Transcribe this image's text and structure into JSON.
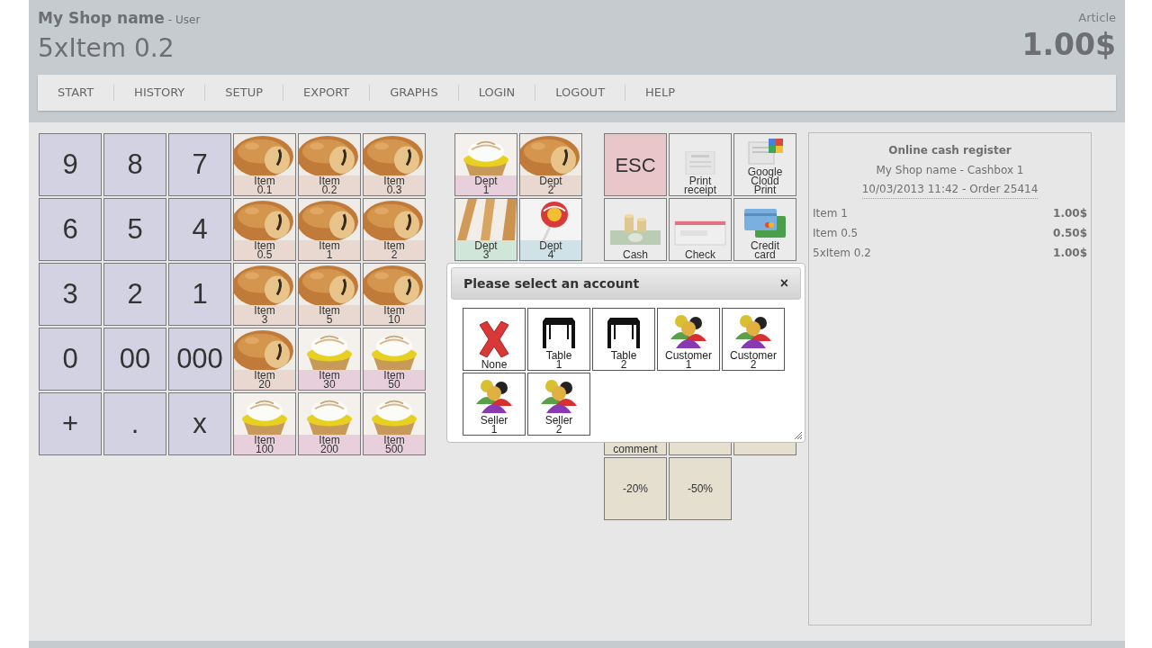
{
  "header": {
    "shop": "My Shop name",
    "user": "- User",
    "line": "5xItem 0.2",
    "total_label": "Article",
    "total": "1.00$"
  },
  "menu": [
    "START",
    "HISTORY",
    "SETUP",
    "EXPORT",
    "GRAPHS",
    "LOGIN",
    "LOGOUT",
    "HELP"
  ],
  "keypad": [
    "9",
    "8",
    "7",
    "6",
    "5",
    "4",
    "3",
    "2",
    "1",
    "0",
    "00",
    "000",
    "+",
    ".",
    "x"
  ],
  "items": [
    {
      "label": "Item 0.1",
      "color": "#e8d8cf"
    },
    {
      "label": "Item 0.2",
      "color": "#e8d8cf"
    },
    {
      "label": "Item 0.3",
      "color": "#e8d8cf"
    },
    {
      "label": "Item 0.5",
      "color": "#e8d8cf"
    },
    {
      "label": "Item 1",
      "color": "#e8d8cf"
    },
    {
      "label": "Item 2",
      "color": "#e8d8cf"
    },
    {
      "label": "Item 3",
      "color": "#e8d8cf"
    },
    {
      "label": "Item 5",
      "color": "#e8d8cf"
    },
    {
      "label": "Item 10",
      "color": "#e8d8cf"
    },
    {
      "label": "Item 20",
      "color": "#e8d8cf"
    },
    {
      "label": "Item 30",
      "color": "#e8cfdc"
    },
    {
      "label": "Item 50",
      "color": "#e8cfdc"
    },
    {
      "label": "Item 100",
      "color": "#e8cfdc"
    },
    {
      "label": "Item 200",
      "color": "#e8cfdc"
    },
    {
      "label": "Item 500",
      "color": "#e8cfdc"
    }
  ],
  "departments": [
    {
      "label": "Dept 1",
      "color": "#e8cfdc"
    },
    {
      "label": "Dept 2",
      "color": "#e8d8cf"
    },
    {
      "label": "Dept 3",
      "color": "#cfe6d8"
    },
    {
      "label": "Dept 4",
      "color": "#cfe2e8"
    }
  ],
  "actions": [
    {
      "label": "ESC",
      "kind": "esc"
    },
    {
      "label": "Print receipt",
      "kind": "receipt"
    },
    {
      "label": "Google Cloud Print",
      "kind": "cloud_print"
    },
    {
      "label": "Cash",
      "kind": "cash"
    },
    {
      "label": "Check",
      "kind": "cheque"
    },
    {
      "label": "Credit card",
      "kind": "card"
    }
  ],
  "lower_actions": [
    {
      "label": "comment",
      "kind": "text"
    },
    {
      "kind": "blank"
    },
    {
      "kind": "blank"
    },
    {
      "label": "-20%",
      "kind": "text"
    },
    {
      "label": "-50%",
      "kind": "text"
    }
  ],
  "dialog": {
    "title": "Please select an account",
    "close": "×",
    "accounts": [
      {
        "label": "None",
        "kind": "none"
      },
      {
        "label": "Table 1",
        "kind": "table"
      },
      {
        "label": "Table 2",
        "kind": "table"
      },
      {
        "label": "Customer 1",
        "kind": "people"
      },
      {
        "label": "Customer 2",
        "kind": "people"
      },
      {
        "label": "Seller 1",
        "kind": "people"
      },
      {
        "label": "Seller 2",
        "kind": "people"
      }
    ]
  },
  "receipt": {
    "title": "Online cash register",
    "shop": "My Shop name - Cashbox 1",
    "date": "10/03/2013 11:42 - Order 25414",
    "lines": [
      {
        "item": "Item 1",
        "price": "1.00$"
      },
      {
        "item": "Item 0.5",
        "price": "0.50$"
      },
      {
        "item": "5xItem 0.2",
        "price": "1.00$"
      }
    ]
  }
}
